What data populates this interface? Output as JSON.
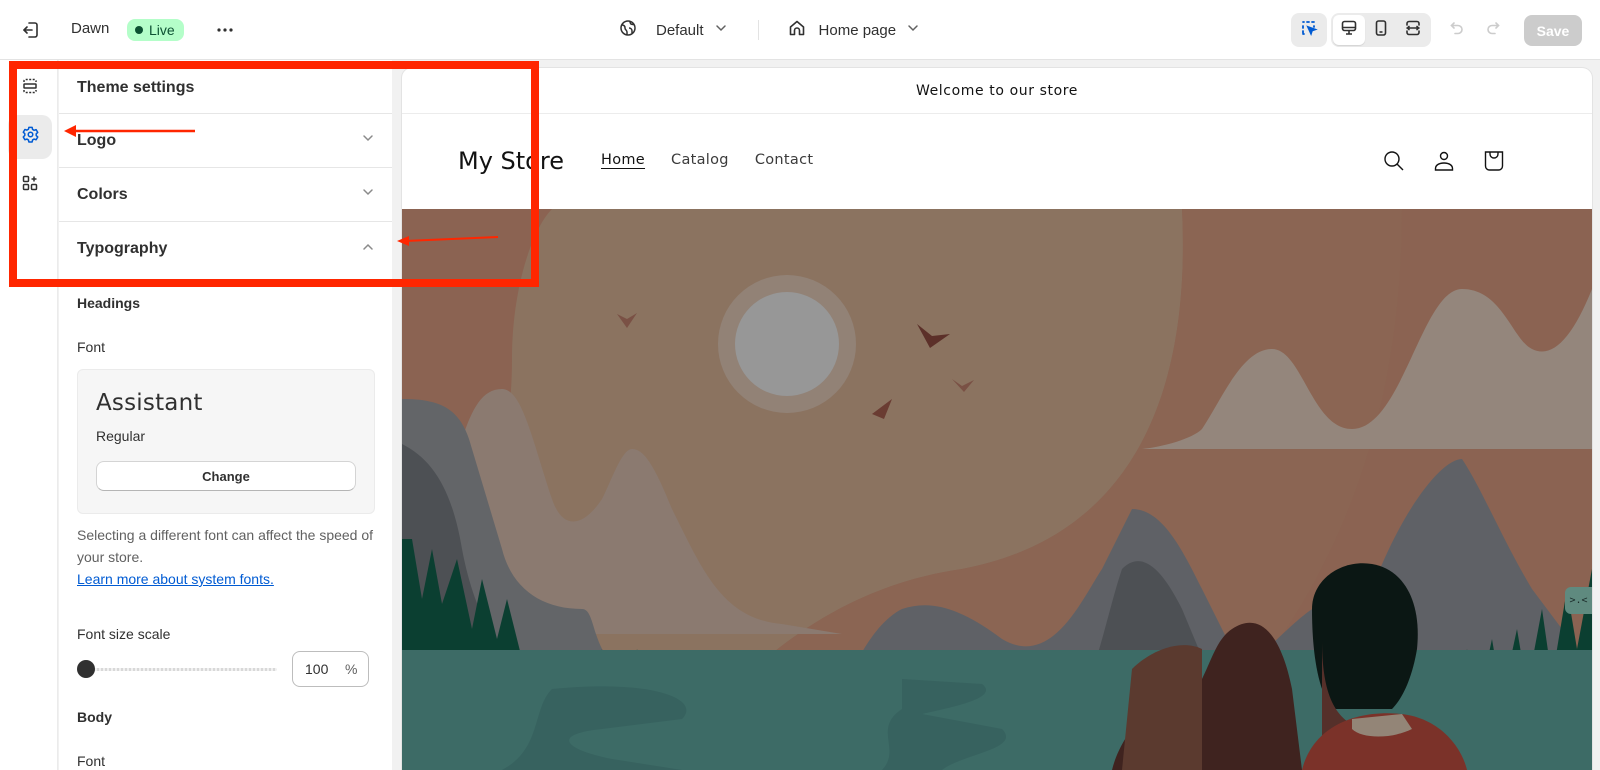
{
  "topbar": {
    "exit_icon": "exit-icon",
    "theme_name": "Dawn",
    "status_badge": "Live",
    "more_icon": "more-horizontal-icon",
    "market_selector": {
      "icon": "globe-icon",
      "label": "Default"
    },
    "page_selector": {
      "icon": "home-icon",
      "label": "Home page"
    },
    "tools": {
      "inspect": "inspector-icon",
      "views": [
        "desktop-icon",
        "mobile-icon",
        "fullscreen-icon"
      ],
      "active_view": "desktop",
      "undo": "undo-icon",
      "redo": "redo-icon"
    },
    "save_label": "Save"
  },
  "rail": {
    "items": [
      {
        "name": "sections",
        "icon": "sections-icon",
        "active": false
      },
      {
        "name": "theme-settings",
        "icon": "gear-icon",
        "active": true
      },
      {
        "name": "apps",
        "icon": "apps-add-icon",
        "active": false
      }
    ]
  },
  "panel": {
    "title": "Theme settings",
    "accordions": [
      {
        "label": "Logo",
        "expanded": false
      },
      {
        "label": "Colors",
        "expanded": false
      },
      {
        "label": "Typography",
        "expanded": true
      }
    ],
    "typography": {
      "headings_label": "Headings",
      "font_label": "Font",
      "font_name": "Assistant",
      "font_style": "Regular",
      "change_label": "Change",
      "help_text": "Selecting a different font can affect the speed of your store.",
      "help_link": "Learn more about system fonts.",
      "scale_label": "Font size scale",
      "scale_value": "100",
      "scale_unit": "%",
      "scale_fraction": 0.0,
      "body_label": "Body",
      "body_font_label": "Font"
    }
  },
  "preview": {
    "announcement": "Welcome to our store",
    "store_name": "My Store",
    "nav": [
      {
        "label": "Home",
        "current": true
      },
      {
        "label": "Catalog",
        "current": false
      },
      {
        "label": "Contact",
        "current": false
      }
    ],
    "header_icons": [
      "search-icon",
      "account-icon",
      "cart-icon"
    ],
    "side_widget": ">.<"
  },
  "annotation": {
    "color": "#ff2600"
  }
}
